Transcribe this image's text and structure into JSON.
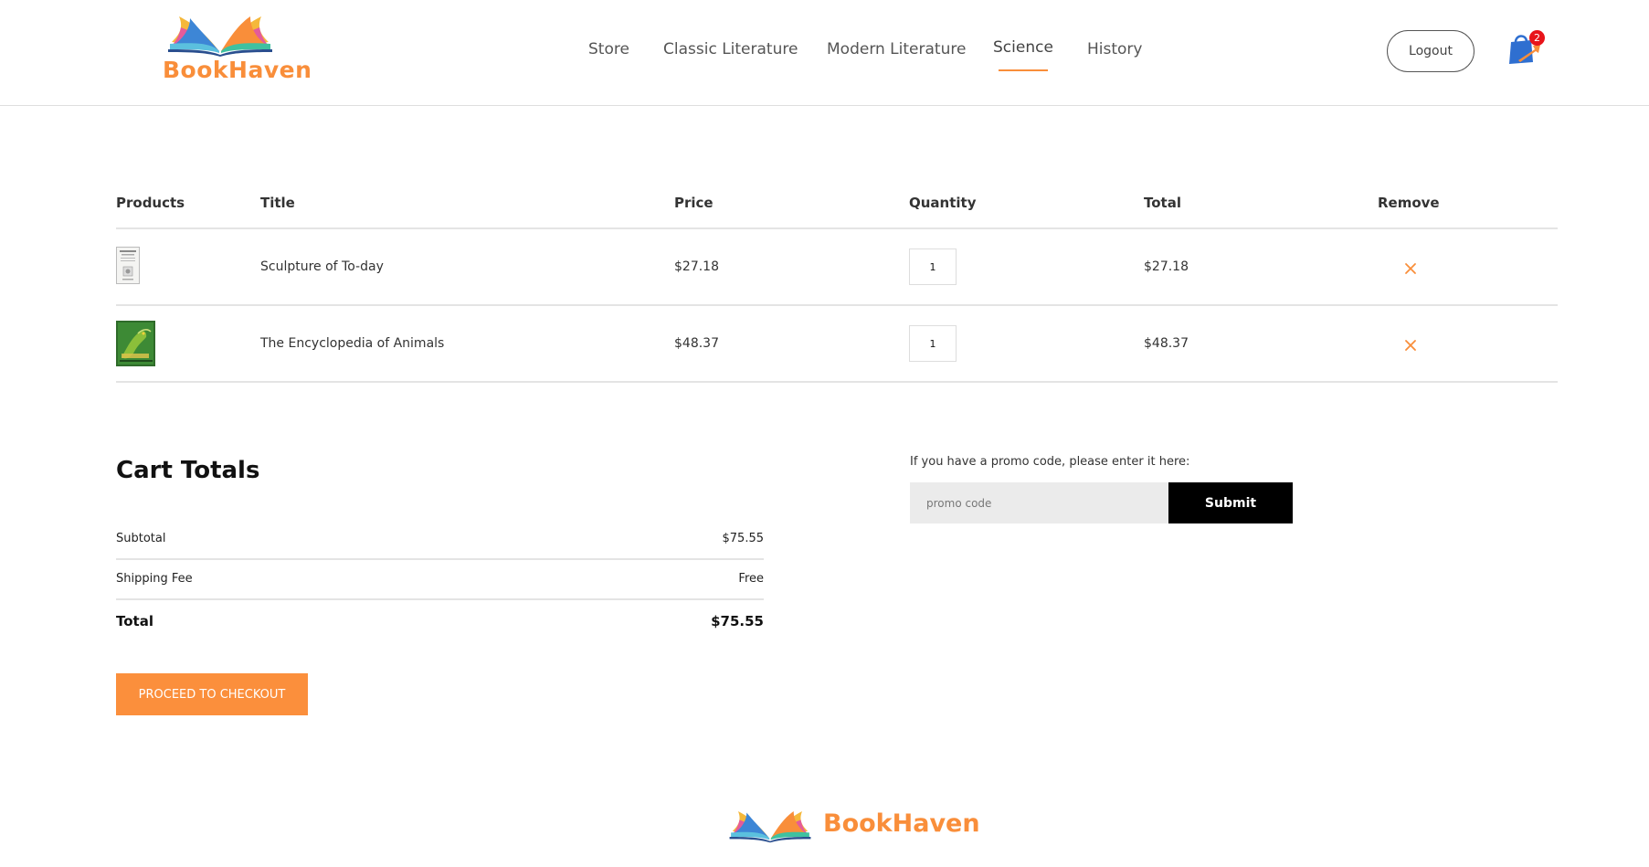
{
  "brand": {
    "name": "BookHaven",
    "accent_color": "#f98e3a"
  },
  "nav": {
    "items": [
      {
        "label": "Store",
        "active": false
      },
      {
        "label": "Classic Literature",
        "active": false
      },
      {
        "label": "Modern Literature",
        "active": false
      },
      {
        "label": "Science",
        "active": true
      },
      {
        "label": "History",
        "active": false
      }
    ]
  },
  "header": {
    "logout_label": "Logout",
    "cart_icon": "shopping-bag-icon",
    "cart_count": "2"
  },
  "cart": {
    "columns": [
      "Products",
      "Title",
      "Price",
      "Quantity",
      "Total",
      "Remove"
    ],
    "rows": [
      {
        "title": "Sculpture of To-day",
        "price": "$27.18",
        "quantity": "1",
        "total": "$27.18",
        "thumb": "book-cover-sculpture",
        "remove_icon": "close-icon"
      },
      {
        "title": "The Encyclopedia of Animals",
        "price": "$48.37",
        "quantity": "1",
        "total": "$48.37",
        "thumb": "book-cover-animals",
        "remove_icon": "close-icon"
      }
    ]
  },
  "totals": {
    "title": "Cart Totals",
    "subtotal_label": "Subtotal",
    "subtotal_value": "$75.55",
    "shipping_label": "Shipping Fee",
    "shipping_value": "Free",
    "total_label": "Total",
    "total_value": "$75.55",
    "checkout_label": "PROCEED TO CHECKOUT",
    "checkout_color": "#fb8f3c"
  },
  "promo": {
    "label": "If you have a promo code, please enter it here:",
    "placeholder": "promo code",
    "value": "",
    "submit_label": "Submit"
  },
  "footer": {
    "brand_name": "BookHaven"
  }
}
